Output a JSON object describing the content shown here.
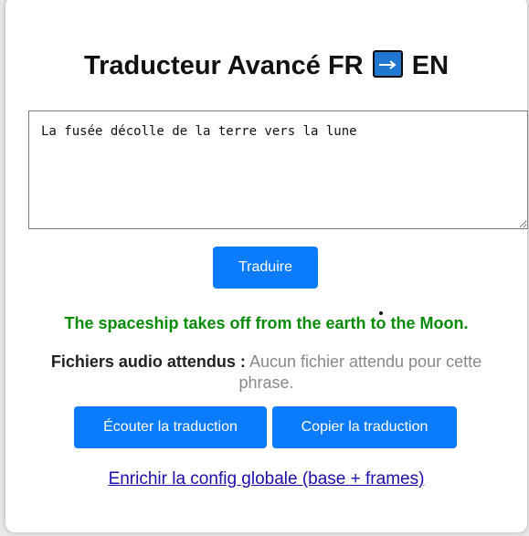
{
  "app": {
    "title_prefix": "Traducteur Avancé FR",
    "title_arrow": "→",
    "title_suffix": "EN"
  },
  "input": {
    "value": "La fusée décolle de la terre vers la lune"
  },
  "buttons": {
    "translate": "Traduire",
    "listen": "Écouter la traduction",
    "copy": "Copier la traduction"
  },
  "result": {
    "text": "The spaceship takes off from the earth to the Moon."
  },
  "audio": {
    "label": "Fichiers audio attendus :",
    "value": "Aucun fichier attendu pour cette phrase."
  },
  "link": {
    "text": "Enrichir la config globale (base + frames)"
  },
  "colors": {
    "accent": "#0b7bff",
    "result": "#0a8a0a",
    "muted": "#888888",
    "link": "#1a0dab"
  }
}
